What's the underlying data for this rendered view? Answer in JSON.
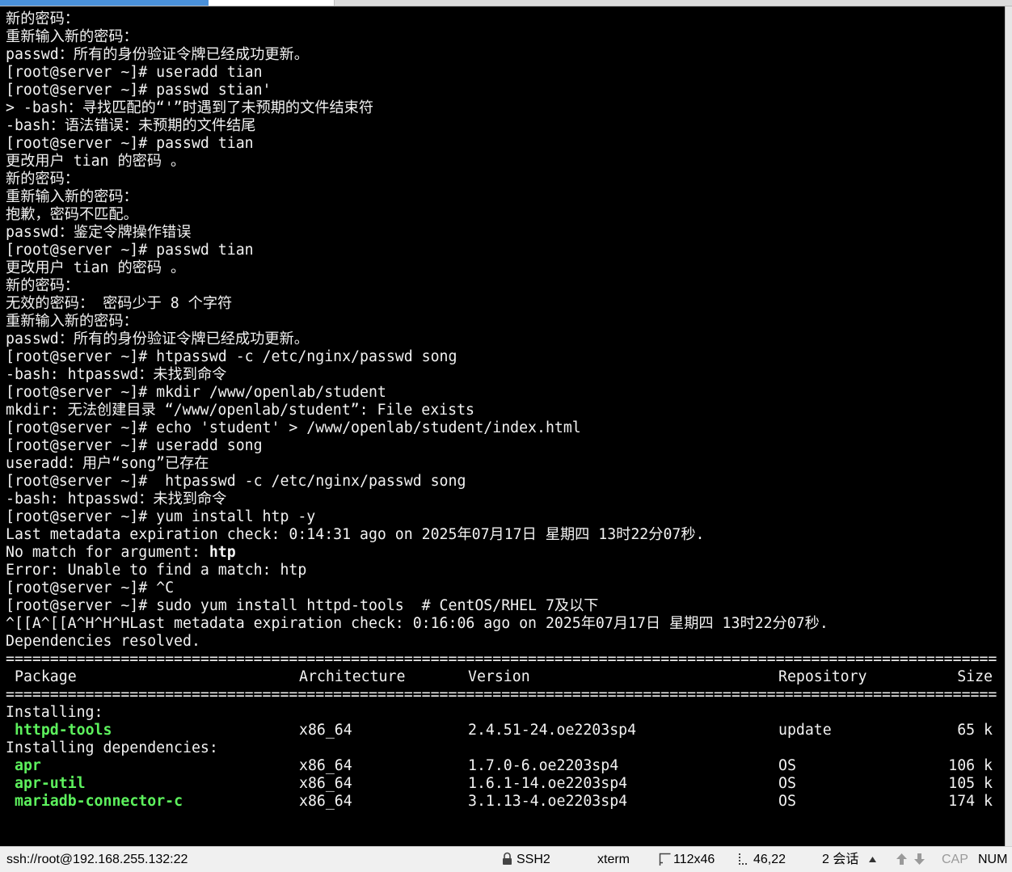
{
  "colors": {
    "terminal_background": "#000000",
    "terminal_foreground": "#f2f2f2",
    "package_highlight": "#5df15d",
    "status_bar_background": "#f0f0f0",
    "accent_tab": "#4a90d9"
  },
  "terminal": {
    "history": [
      "新的密码：",
      "重新输入新的密码：",
      "passwd：所有的身份验证令牌已经成功更新。",
      "[root@server ~]# useradd tian",
      "[root@server ~]# passwd stian'",
      "> -bash：寻找匹配的“'”时遇到了未预期的文件结束符",
      "-bash：语法错误：未预期的文件结尾",
      "[root@server ~]# passwd tian",
      "更改用户 tian 的密码 。",
      "新的密码：",
      "重新输入新的密码：",
      "抱歉，密码不匹配。",
      "passwd：鉴定令牌操作错误",
      "[root@server ~]# passwd tian",
      "更改用户 tian 的密码 。",
      "新的密码：",
      "无效的密码： 密码少于 8 个字符",
      "重新输入新的密码：",
      "passwd：所有的身份验证令牌已经成功更新。",
      "[root@server ~]# htpasswd -c /etc/nginx/passwd song",
      "-bash: htpasswd：未找到命令",
      "[root@server ~]# mkdir /www/openlab/student",
      "mkdir: 无法创建目录 “/www/openlab/student”: File exists",
      "[root@server ~]# echo 'student' > /www/openlab/student/index.html",
      "[root@server ~]# useradd song",
      "useradd：用户“song”已存在",
      "[root@server ~]#  htpasswd -c /etc/nginx/passwd song",
      "-bash: htpasswd：未找到命令",
      "[root@server ~]# yum install htp -y",
      "Last metadata expiration check: 0:14:31 ago on 2025年07月17日 星期四 13时22分07秒."
    ],
    "no_match_label": "No match for argument: ",
    "no_match_arg": "htp",
    "after": [
      "Error: Unable to find a match: htp",
      "[root@server ~]# ^C",
      "[root@server ~]# sudo yum install httpd-tools  # CentOS/RHEL 7及以下",
      "^[[A^[[A^H^H^HLast metadata expiration check: 0:16:06 ago on 2025年07月17日 星期四 13时22分07秒.",
      "Dependencies resolved."
    ],
    "separator": "================================================================================================================",
    "table": {
      "columns": [
        "Package",
        "Architecture",
        "Version",
        "Repository",
        "Size"
      ],
      "installing_label": "Installing:",
      "installing": [
        {
          "package": "httpd-tools",
          "arch": "x86_64",
          "version": "2.4.51-24.oe2203sp4",
          "repo": "update",
          "size": "65 k"
        }
      ],
      "dependencies_label": "Installing dependencies:",
      "dependencies": [
        {
          "package": "apr",
          "arch": "x86_64",
          "version": "1.7.0-6.oe2203sp4",
          "repo": "OS",
          "size": "106 k"
        },
        {
          "package": "apr-util",
          "arch": "x86_64",
          "version": "1.6.1-14.oe2203sp4",
          "repo": "OS",
          "size": "105 k"
        },
        {
          "package": "mariadb-connector-c",
          "arch": "x86_64",
          "version": "3.1.13-4.oe2203sp4",
          "repo": "OS",
          "size": "174 k"
        }
      ]
    }
  },
  "status": {
    "connection": "ssh://root@192.168.255.132:22",
    "protocol": "SSH2",
    "terminal_type": "xterm",
    "size": "112x46",
    "cursor": "46,22",
    "sessions": "2 会话",
    "cap": "CAP",
    "num": "NUM",
    "icons": [
      "lock-icon",
      "terminal-size-icon",
      "cursor-position-icon",
      "sessions-menu-icon",
      "previous-session-icon",
      "next-session-icon"
    ]
  }
}
